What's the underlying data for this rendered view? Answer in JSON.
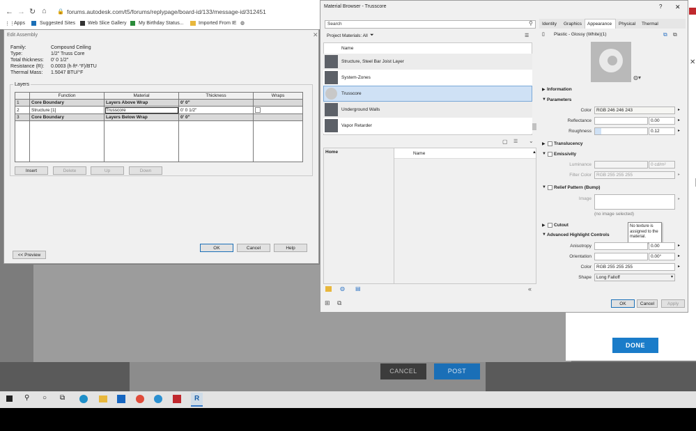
{
  "browser": {
    "url": "forums.autodesk.com/t5/forums/replypage/board-id/133/message-id/312451",
    "bookmarks": [
      "Apps",
      "Suggested Sites",
      "Web Slice Gallery",
      "My Birthday Status...",
      "Imported From IE"
    ]
  },
  "page": {
    "done_label": "DONE",
    "cancel_label": "CANCEL",
    "post_label": "POST"
  },
  "edit_assembly": {
    "title": "Edit Assembly",
    "props": [
      {
        "label": "Family:",
        "value": "Compound Ceiling"
      },
      {
        "label": "Type:",
        "value": "1/2\" Truss Core"
      },
      {
        "label": "Total thickness:",
        "value": "0' 0 1/2\""
      },
      {
        "label": "Resistance (R):",
        "value": "0.0003 (h·ft²·°F)/BTU"
      },
      {
        "label": "Thermal Mass:",
        "value": "1.5047 BTU/°F"
      }
    ],
    "layers_label": "Layers",
    "columns": [
      "Function",
      "Material",
      "Thickness",
      "Wraps"
    ],
    "rows": [
      {
        "n": "1",
        "function": "Core Boundary",
        "material": "Layers Above Wrap",
        "thickness": "0' 0\""
      },
      {
        "n": "2",
        "function": "Structure [1]",
        "material": "Trusscore",
        "thickness": "0' 0 1/2\""
      },
      {
        "n": "3",
        "function": "Core Boundary",
        "material": "Layers Below Wrap",
        "thickness": "0' 0\""
      }
    ],
    "btn_insert": "Insert",
    "btn_delete": "Delete",
    "btn_up": "Up",
    "btn_down": "Down",
    "btn_ok": "OK",
    "btn_cancel": "Cancel",
    "btn_help": "Help",
    "btn_preview": "<< Preview"
  },
  "material_browser": {
    "title": "Material Browser - Trusscore",
    "help": "?",
    "close": "✕",
    "search_placeholder": "Search",
    "filter_label": "Project Materials: All",
    "name_header": "Name",
    "materials": [
      "Structure, Steel Bar Joist Layer",
      "System-Zones",
      "Trusscore",
      "Underground Walls",
      "Vapor Retarder"
    ],
    "library_home": "Home",
    "library_name_header": "Name",
    "tabs": [
      "Identity",
      "Graphics",
      "Appearance",
      "Physical",
      "Thermal"
    ],
    "asset_name": "Plastic - Glossy (White)(1)",
    "sections": {
      "information": "Information",
      "parameters": "Parameters",
      "translucency": "Translucency",
      "emissivity": "Emissivity",
      "relief": "Relief Pattern (Bump)",
      "cutout": "Cutout",
      "advanced": "Advanced Highlight Controls"
    },
    "params": {
      "color_label": "Color",
      "color_value": "RGB 246 246 243",
      "reflectance_label": "Reflectance",
      "reflectance_value": "0.00",
      "roughness_label": "Roughness",
      "roughness_value": "0.12",
      "roughness_fraction": 0.12
    },
    "emissivity_params": {
      "luminance_label": "Luminance",
      "luminance_value": "0 cd/m²",
      "filter_label": "Filter Color",
      "filter_value": "RGB 255 255 255"
    },
    "relief": {
      "image_label": "Image",
      "no_image": "(no image selected)"
    },
    "tooltip": "No texture is assigned to the material.",
    "advanced": {
      "anisotropy_label": "Anisotropy",
      "anisotropy_value": "0.00",
      "orientation_label": "Orientation",
      "orientation_value": "0.00°",
      "color_label": "Color",
      "color_value": "RGB 255 255 255",
      "shape_label": "Shape",
      "shape_value": "Long Falloff"
    },
    "btn_ok": "OK",
    "btn_cancel": "Cancel",
    "btn_apply": "Apply"
  },
  "colors": {
    "accent": "#1a6fb7",
    "selection": "#cfe1f5",
    "done_button": "#1a7cc9",
    "post_button": "#1a6fb7"
  }
}
